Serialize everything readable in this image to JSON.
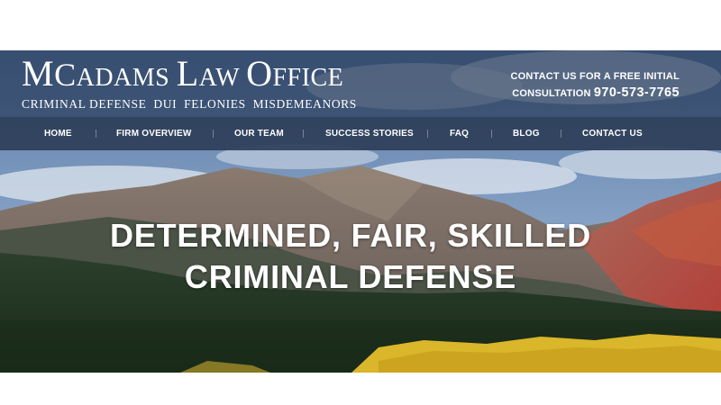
{
  "site": {
    "logo": {
      "title_lead": "M",
      "title_rest_1": "C",
      "title_rest_2": "ADAMS ",
      "title_lead_2": "L",
      "title_rest_3": "AW ",
      "title_lead_3": "O",
      "title_rest_4": "FFICE",
      "tagline": "CRIMINAL DEFENSE  DUI  FELONIES  MISDEMEANORS"
    },
    "contact": {
      "line1": "CONTACT US FOR A FREE INITIAL",
      "line2": "CONSULTATION",
      "phone": "970-573-7765"
    },
    "nav": [
      "HOME",
      "FIRM OVERVIEW",
      "OUR TEAM",
      "SUCCESS STORIES",
      "FAQ",
      "BLOG",
      "CONTACT US"
    ],
    "hero": {
      "line1": "DETERMINED, FAIR, SKILLED",
      "line2": "CRIMINAL DEFENSE"
    }
  },
  "colors": {
    "header_bg": "#223450",
    "nav_bg": "#2c3e58",
    "text": "#ffffff",
    "aspen_yellow": "#d9b62a",
    "forest": "#1f3320"
  }
}
